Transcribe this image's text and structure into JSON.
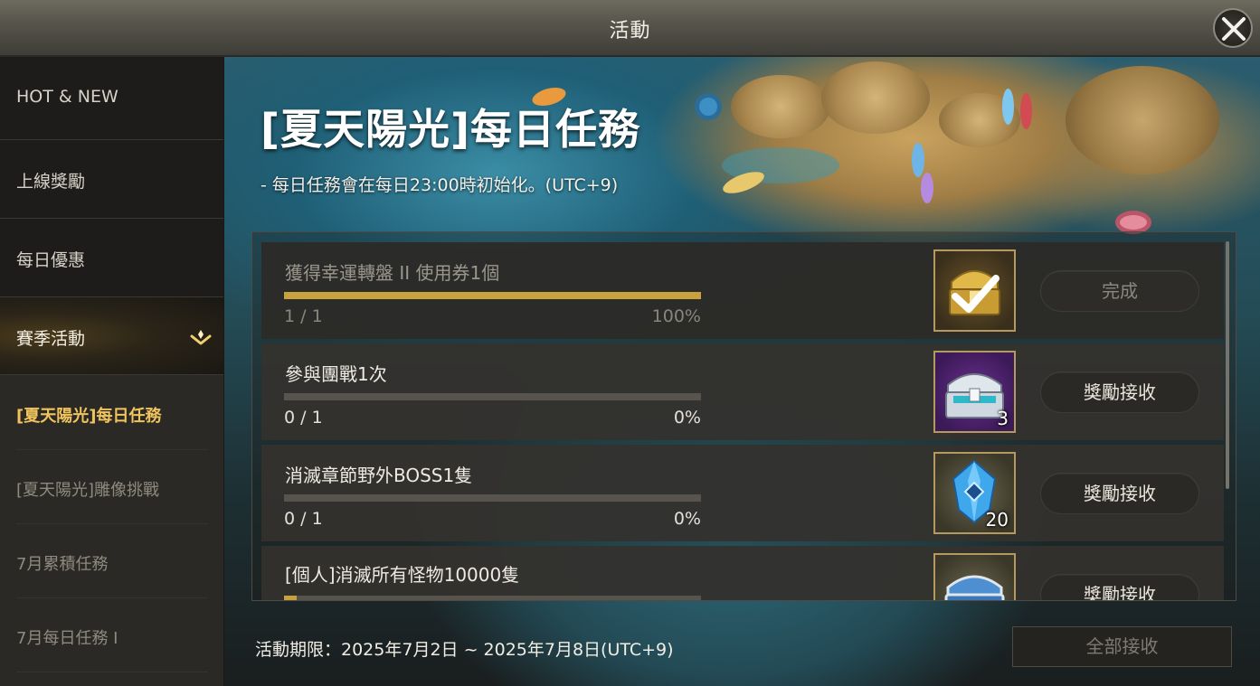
{
  "window": {
    "title": "活動"
  },
  "sidebar": {
    "items": [
      {
        "label": "HOT & NEW"
      },
      {
        "label": "上線獎勵"
      },
      {
        "label": "每日優惠"
      },
      {
        "label": "賽季活動"
      }
    ],
    "sub_items": [
      {
        "label": "[夏天陽光]每日任務"
      },
      {
        "label": "[夏天陽光]雕像挑戰"
      },
      {
        "label": "7月累積任務"
      },
      {
        "label": "7月每日任務 Ⅰ"
      }
    ]
  },
  "banner": {
    "title": "[夏天陽光]每日任務",
    "subtitle": "- 每日任務會在每日23:00時初始化。(UTC+9)"
  },
  "missions": [
    {
      "name": "獲得幸運轉盤 II 使用券1個",
      "count": "1 / 1",
      "percent": "100%",
      "progress": 1.0,
      "reward_icon": "golden-chest-checkmark-icon",
      "reward_qty": "",
      "button": "完成",
      "status": "completed"
    },
    {
      "name": "參與團戰1次",
      "count": "0 / 1",
      "percent": "0%",
      "progress": 0.0,
      "reward_icon": "silver-treasure-chest-icon",
      "reward_qty": "3",
      "button": "獎勵接收",
      "status": "claimable"
    },
    {
      "name": "消滅章節野外BOSS1隻",
      "count": "0 / 1",
      "percent": "0%",
      "progress": 0.0,
      "reward_icon": "blue-crystal-icon",
      "reward_qty": "20",
      "button": "獎勵接收",
      "status": "claimable"
    },
    {
      "name": "[個人]消滅所有怪物10000隻",
      "count": "",
      "percent": "",
      "progress": 0.03,
      "reward_icon": "blue-treasure-chest-icon",
      "reward_qty": "",
      "button": "獎勵接收",
      "status": "claimable"
    }
  ],
  "footer": {
    "period": "活動期限：2025年7月2日 ~ 2025年7月8日(UTC+9)",
    "claim_all": "全部接收"
  },
  "colors": {
    "accent_gold": "#c9a240",
    "active_sub_item": "#f0c45c"
  }
}
